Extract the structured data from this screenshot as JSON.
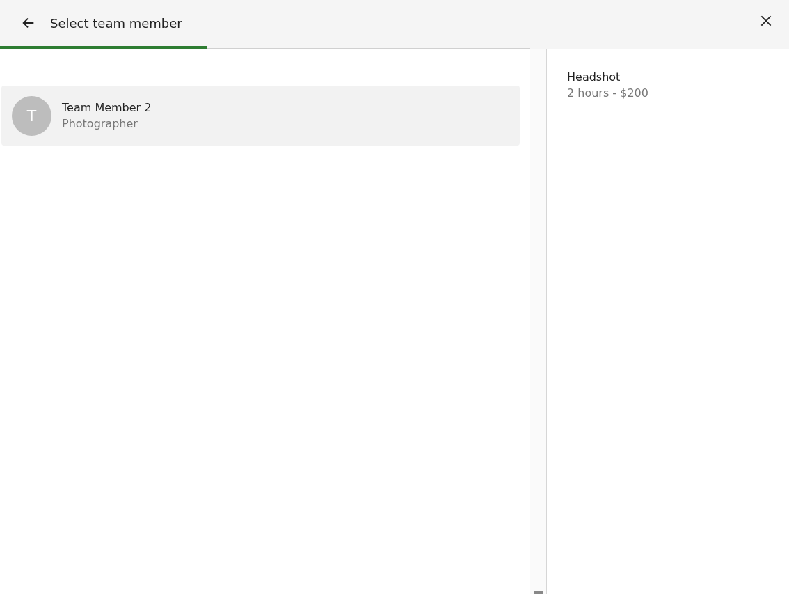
{
  "header": {
    "title": "Select team member",
    "progress": {
      "level": 0.39
    }
  },
  "members": [
    {
      "initial": "T",
      "name": "Team Member 2",
      "role": "Photographer",
      "selected": false
    }
  ],
  "summary": {
    "service": "Headshot",
    "details": "2 hours - $200"
  }
}
